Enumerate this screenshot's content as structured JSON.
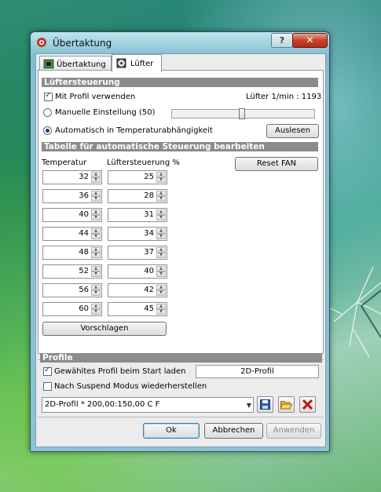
{
  "window": {
    "title": "Übertaktung",
    "help_label": "?",
    "close_label": "✕"
  },
  "tabs": [
    {
      "label": "Übertaktung",
      "icon": "overclock-board-icon"
    },
    {
      "label": "Lüfter",
      "icon": "fan-icon"
    }
  ],
  "fan_control": {
    "section_title": "Lüftersteuerung",
    "use_profile_label": "Mit Profil verwenden",
    "use_profile_checked": true,
    "fan_rpm_label": "Lüfter 1/min : 1193",
    "manual_label": "Manuelle Einstellung (50)",
    "manual_selected": false,
    "slider_value_percent": 50,
    "auto_label": "Automatisch in Temperaturabhängigkeit",
    "auto_selected": true,
    "read_button": "Auslesen"
  },
  "table": {
    "section_title": "Tabelle für automatische Steuerung bearbeiten",
    "col_temperature": "Temperatur",
    "col_fan": "Lüftersteuerung %",
    "reset_button": "Reset FAN",
    "temperatures": [
      "32",
      "36",
      "40",
      "44",
      "48",
      "52",
      "56",
      "60"
    ],
    "fan_values": [
      "25",
      "28",
      "31",
      "34",
      "37",
      "40",
      "42",
      "45"
    ],
    "suggest_button": "Vorschlagen"
  },
  "profile": {
    "section_title": "Profile",
    "load_on_start_label": "Gewähltes Profil beim Start laden",
    "load_on_start_checked": true,
    "selected_profile": "2D-Profil",
    "restore_suspend_label": "Nach Suspend Modus wiederherstellen",
    "restore_suspend_checked": false,
    "combo_value": "2D-Profil * 200,00:150,00 C  F"
  },
  "buttons": {
    "ok": "Ok",
    "cancel": "Abbrechen",
    "apply": "Anwenden"
  },
  "colors": {
    "section_header": "#8c8c8c",
    "close_button": "#c9412b",
    "window_frame": "#8cc4d3"
  }
}
